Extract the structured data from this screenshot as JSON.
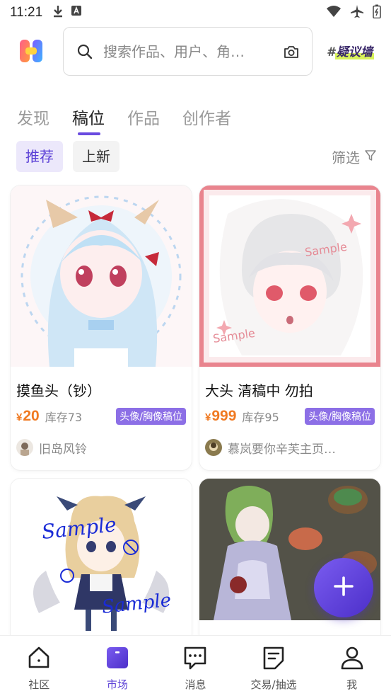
{
  "status_bar": {
    "time": "11:21"
  },
  "search": {
    "placeholder": "搜索作品、用户、角…"
  },
  "brand_badge": {
    "hash": "#",
    "text": "疑议墙"
  },
  "tabs": [
    {
      "label": "发现",
      "active": false
    },
    {
      "label": "稿位",
      "active": true
    },
    {
      "label": "作品",
      "active": false
    },
    {
      "label": "创作者",
      "active": false
    }
  ],
  "filters": {
    "chips": [
      {
        "label": "推荐",
        "active": true
      },
      {
        "label": "上新",
        "active": false
      }
    ],
    "screen_label": "筛选"
  },
  "cards": [
    {
      "title": "摸鱼头（钞）",
      "currency": "¥",
      "price": "20",
      "stock": "库存73",
      "tag": "头像/胸像稿位",
      "author": "旧岛风铃"
    },
    {
      "title": "大头 清稿中 勿拍",
      "currency": "¥",
      "price": "999",
      "stock": "库存95",
      "tag": "头像/胸像稿位",
      "author": "慕岚要你辛芙主页…"
    },
    {
      "title": "",
      "image_text": [
        "Sample",
        "Sample"
      ]
    },
    {
      "title": ""
    }
  ],
  "bottom_nav": [
    {
      "label": "社区",
      "icon": "home-icon",
      "active": false
    },
    {
      "label": "市场",
      "icon": "market-icon",
      "active": true
    },
    {
      "label": "消息",
      "icon": "message-icon",
      "active": false
    },
    {
      "label": "交易/抽选",
      "icon": "trade-icon",
      "active": false
    },
    {
      "label": "我",
      "icon": "profile-icon",
      "active": false
    }
  ],
  "colors": {
    "accent": "#5a3fd6",
    "price": "#f07a22",
    "tag_bg": "#8c6fe6"
  }
}
